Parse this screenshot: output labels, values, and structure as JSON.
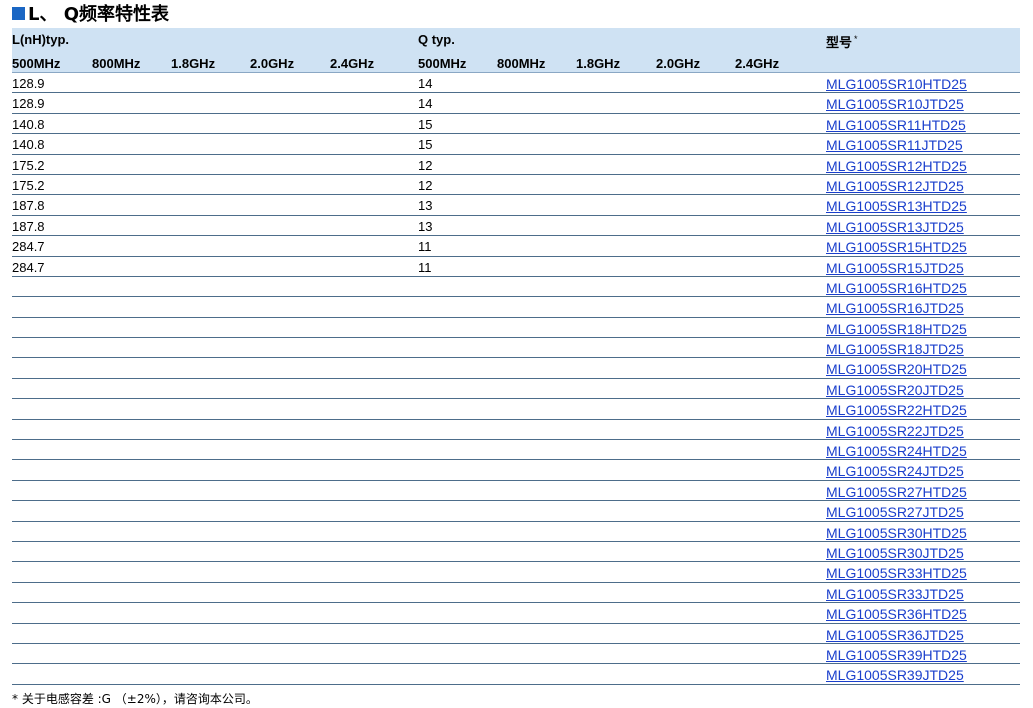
{
  "title": {
    "prefix": "L、 Q频率特性表"
  },
  "header": {
    "l_group": "L(nH)typ.",
    "q_group": "Q typ.",
    "model_group": "型号",
    "model_mark": "*",
    "l_freqs": [
      "500MHz",
      "800MHz",
      "1.8GHz",
      "2.0GHz",
      "2.4GHz"
    ],
    "q_freqs": [
      "500MHz",
      "800MHz",
      "1.8GHz",
      "2.0GHz",
      "2.4GHz"
    ]
  },
  "rows": [
    {
      "l": "128.9",
      "q": "14",
      "model": "MLG1005SR10HTD25"
    },
    {
      "l": "128.9",
      "q": "14",
      "model": "MLG1005SR10JTD25"
    },
    {
      "l": "140.8",
      "q": "15",
      "model": "MLG1005SR11HTD25"
    },
    {
      "l": "140.8",
      "q": "15",
      "model": "MLG1005SR11JTD25"
    },
    {
      "l": "175.2",
      "q": "12",
      "model": "MLG1005SR12HTD25"
    },
    {
      "l": "175.2",
      "q": "12",
      "model": "MLG1005SR12JTD25"
    },
    {
      "l": "187.8",
      "q": "13",
      "model": "MLG1005SR13HTD25"
    },
    {
      "l": "187.8",
      "q": "13",
      "model": "MLG1005SR13JTD25"
    },
    {
      "l": "284.7",
      "q": "11",
      "model": "MLG1005SR15HTD25"
    },
    {
      "l": "284.7",
      "q": "11",
      "model": "MLG1005SR15JTD25"
    },
    {
      "l": "",
      "q": "",
      "model": "MLG1005SR16HTD25"
    },
    {
      "l": "",
      "q": "",
      "model": "MLG1005SR16JTD25"
    },
    {
      "l": "",
      "q": "",
      "model": "MLG1005SR18HTD25"
    },
    {
      "l": "",
      "q": "",
      "model": "MLG1005SR18JTD25"
    },
    {
      "l": "",
      "q": "",
      "model": "MLG1005SR20HTD25"
    },
    {
      "l": "",
      "q": "",
      "model": "MLG1005SR20JTD25"
    },
    {
      "l": "",
      "q": "",
      "model": "MLG1005SR22HTD25"
    },
    {
      "l": "",
      "q": "",
      "model": "MLG1005SR22JTD25"
    },
    {
      "l": "",
      "q": "",
      "model": "MLG1005SR24HTD25"
    },
    {
      "l": "",
      "q": "",
      "model": "MLG1005SR24JTD25"
    },
    {
      "l": "",
      "q": "",
      "model": "MLG1005SR27HTD25"
    },
    {
      "l": "",
      "q": "",
      "model": "MLG1005SR27JTD25"
    },
    {
      "l": "",
      "q": "",
      "model": "MLG1005SR30HTD25"
    },
    {
      "l": "",
      "q": "",
      "model": "MLG1005SR30JTD25"
    },
    {
      "l": "",
      "q": "",
      "model": "MLG1005SR33HTD25"
    },
    {
      "l": "",
      "q": "",
      "model": "MLG1005SR33JTD25"
    },
    {
      "l": "",
      "q": "",
      "model": "MLG1005SR36HTD25"
    },
    {
      "l": "",
      "q": "",
      "model": "MLG1005SR36JTD25"
    },
    {
      "l": "",
      "q": "",
      "model": "MLG1005SR39HTD25"
    },
    {
      "l": "",
      "q": "",
      "model": "MLG1005SR39JTD25"
    }
  ],
  "footnote": "* 关于电感容差 :G （±2%），请咨询本公司。",
  "colors": {
    "header_bg": "#cfe2f3",
    "link": "#1a3fcc",
    "accent": "#1a66c4"
  }
}
